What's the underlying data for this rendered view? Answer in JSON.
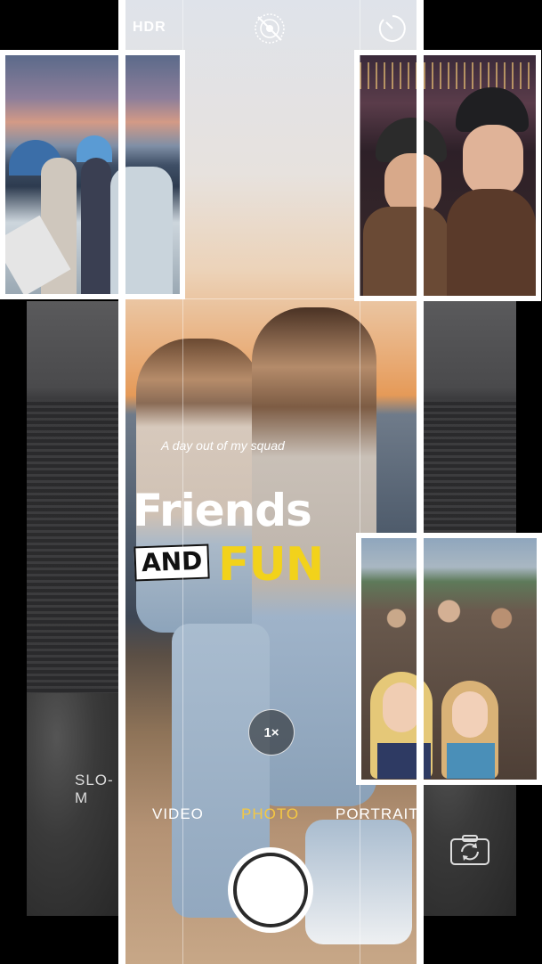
{
  "top_bar": {
    "hdr_label": "HDR",
    "live_icon": "live-photo-off-icon",
    "timer_icon": "timer-icon"
  },
  "overlay_text": {
    "caption": "A day out of my squad",
    "headline_line1": "Friends",
    "headline_and": "AND",
    "headline_fun": "FUN",
    "fun_color": "#f2d21b"
  },
  "zoom": {
    "label": "1×"
  },
  "modes": {
    "slomo_label": "SLO-M",
    "video_label": "VIDEO",
    "photo_label": "PHOTO",
    "portrait_label": "PORTRAIT",
    "active_color": "#f5c842"
  },
  "controls": {
    "flip_camera_icon": "flip-camera-icon",
    "shutter_icon": "shutter-button"
  }
}
